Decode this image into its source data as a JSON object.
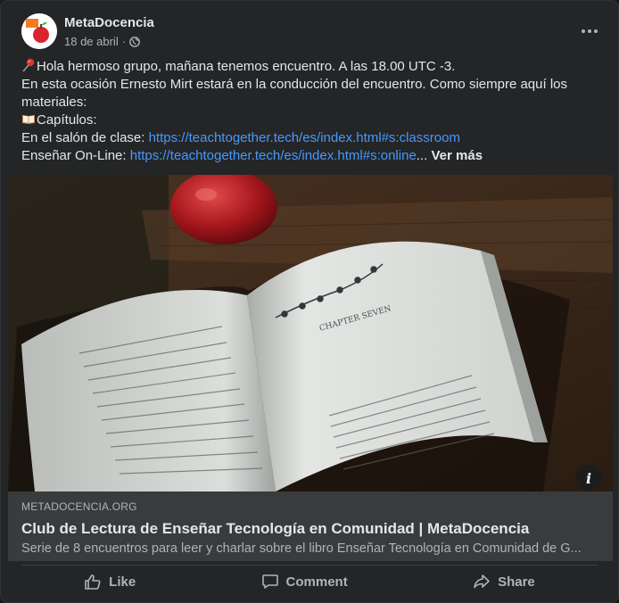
{
  "post": {
    "page_name": "MetaDocencia",
    "date": "18 de abril",
    "separator": "·",
    "privacy_icon": "globe-icon",
    "more_icon": "more-horizontal-icon"
  },
  "text": {
    "line1": "Hola hermoso grupo, mañana tenemos encuentro.  A las 18.00 UTC -3.",
    "line1_emoji": "round-pushpin-emoji",
    "line2": "En esta ocasión Ernesto Mirt estará en la conducción del encuentro.  Como siempre aquí los materiales:",
    "line3_emoji": "open-book-emoji",
    "line3": "Capítulos:",
    "line4_label": "En el salón de clase: ",
    "line4_link": "https://teachtogether.tech/es/index.html#s:classroom",
    "line5_label": "Enseñar On-Line: ",
    "line5_link": "https://teachtogether.tech/es/index.html#s:online",
    "ellipsis": "...",
    "see_more": "Ver más"
  },
  "image": {
    "description_icon": "open-book-with-apple-photo",
    "info_icon": "info-icon"
  },
  "link_preview": {
    "domain": "METADOCENCIA.ORG",
    "title": "Club de Lectura de Enseñar Tecnología en Comunidad | MetaDocencia",
    "description": "Serie de 8 encuentros para leer y charlar sobre el libro Enseñar Tecnología en Comunidad de G..."
  },
  "actions": {
    "like": "Like",
    "comment": "Comment",
    "share": "Share"
  },
  "colors": {
    "card_bg": "#242526",
    "link": "#4599ff",
    "secondary_text": "#b0b3b8",
    "primary_text": "#e4e6eb",
    "preview_bg": "#3a3b3c"
  }
}
